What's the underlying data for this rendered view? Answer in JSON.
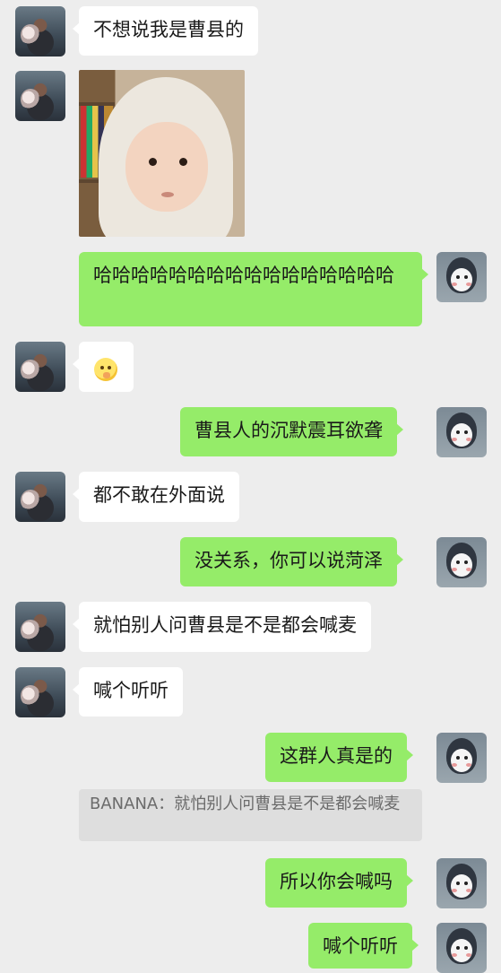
{
  "messages": [
    {
      "from": "left",
      "text": "不想说我是曹县的"
    },
    {
      "from": "left",
      "type": "image",
      "image": "child-photo"
    },
    {
      "from": "right",
      "text": "哈哈哈哈哈哈哈哈哈哈哈哈哈哈哈哈"
    },
    {
      "from": "left",
      "type": "emoji",
      "icon": "shushing-face-emoji"
    },
    {
      "from": "right",
      "text": "曹县人的沉默震耳欲聋"
    },
    {
      "from": "left",
      "text": "都不敢在外面说"
    },
    {
      "from": "right",
      "text": "没关系，你可以说菏泽"
    },
    {
      "from": "left",
      "text": "就怕别人问曹县是不是都会喊麦"
    },
    {
      "from": "left",
      "text": "喊个听听"
    },
    {
      "from": "right",
      "text": "这群人真是的",
      "quote": "BANANA：就怕别人问曹县是不是都会喊麦"
    },
    {
      "from": "right",
      "text": "所以你会喊吗"
    },
    {
      "from": "right",
      "text": "喊个听听"
    }
  ],
  "avatars": {
    "left": "girl-avatar",
    "right": "penguin-avatar"
  },
  "colors": {
    "background": "#ededed",
    "incoming": "#ffffff",
    "outgoing": "#95ec69",
    "quote": "#dedede"
  }
}
